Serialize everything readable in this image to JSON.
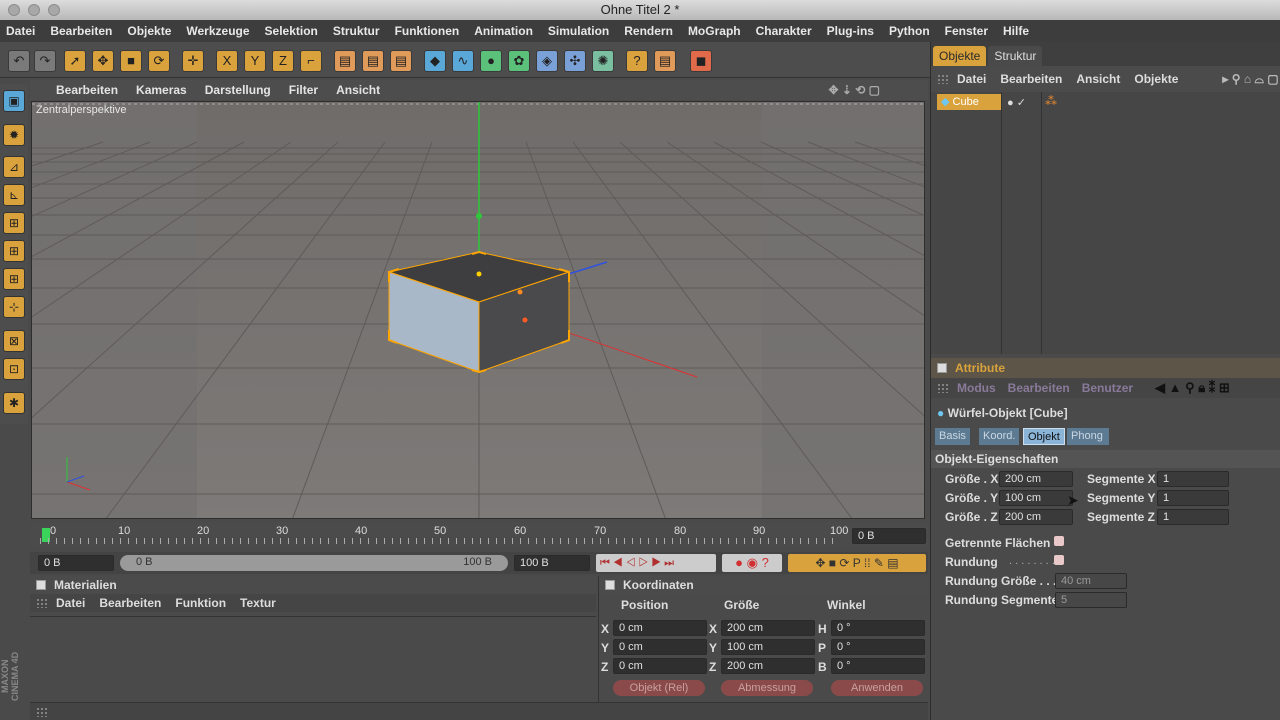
{
  "window": {
    "title": "Ohne Titel 2 *"
  },
  "menu": [
    "Datei",
    "Bearbeiten",
    "Objekte",
    "Werkzeuge",
    "Selektion",
    "Struktur",
    "Funktionen",
    "Animation",
    "Simulation",
    "Rendern",
    "MoGraph",
    "Charakter",
    "Plug-ins",
    "Python",
    "Fenster",
    "Hilfe"
  ],
  "toolbar_icons": [
    "undo-icon",
    "redo-icon",
    "select-icon",
    "move-icon",
    "scale-icon",
    "rotate-icon",
    "move-tool-icon",
    "x-axis-icon",
    "y-axis-icon",
    "z-axis-icon",
    "coordinate-system-icon",
    "render-view-icon",
    "render-picture-icon",
    "render-settings-icon",
    "cube-primitive-icon",
    "nurbs-icon",
    "generator-icon",
    "deformer-icon",
    "environment-icon",
    "camera-icon",
    "light-icon",
    "scene-icon",
    "python-icon"
  ],
  "toolbar_labels": {
    "x": "X",
    "y": "Y",
    "z": "Z"
  },
  "viewport": {
    "menu": [
      "Bearbeiten",
      "Kameras",
      "Darstellung",
      "Filter",
      "Ansicht"
    ],
    "label": "Zentralperspektive",
    "accent": "#ffa500"
  },
  "timeline": {
    "ticks": [
      "0",
      "10",
      "20",
      "30",
      "40",
      "50",
      "60",
      "70",
      "80",
      "90",
      "100"
    ],
    "current": "0 B"
  },
  "transport": {
    "start": "0 B",
    "range_start": "0 B",
    "range_end": "100 B",
    "end": "100 B"
  },
  "materials": {
    "title": "Materialien",
    "menu": [
      "Datei",
      "Bearbeiten",
      "Funktion",
      "Textur"
    ]
  },
  "coordinates": {
    "title": "Koordinaten",
    "headers": [
      "Position",
      "Größe",
      "Winkel"
    ],
    "rows": [
      {
        "axis": "X",
        "pos": "0 cm",
        "size_axis": "X",
        "size": "200 cm",
        "rot_axis": "H",
        "rot": "0 °"
      },
      {
        "axis": "Y",
        "pos": "0 cm",
        "size_axis": "Y",
        "size": "100 cm",
        "rot_axis": "P",
        "rot": "0 °"
      },
      {
        "axis": "Z",
        "pos": "0 cm",
        "size_axis": "Z",
        "size": "200 cm",
        "rot_axis": "B",
        "rot": "0 °"
      }
    ],
    "buttons": [
      "Objekt (Rel)",
      "Abmessung",
      "Anwenden"
    ]
  },
  "objects": {
    "tabs": [
      "Objekte",
      "Struktur"
    ],
    "menu": [
      "Datei",
      "Bearbeiten",
      "Ansicht",
      "Objekte"
    ],
    "items": [
      {
        "name": "Cube"
      }
    ]
  },
  "attributes": {
    "title": "Attribute",
    "menu": [
      "Modus",
      "Bearbeiten",
      "Benutzer"
    ],
    "object_title": "Würfel-Objekt [Cube]",
    "tabs": [
      "Basis",
      "Koord.",
      "Objekt",
      "Phong"
    ],
    "section": "Objekt-Eigenschaften",
    "fields": [
      {
        "label": "Größe . X",
        "value": "200 cm",
        "seg_label": "Segmente X",
        "seg": "1"
      },
      {
        "label": "Größe . Y",
        "value": "100 cm",
        "seg_label": "Segmente Y",
        "seg": "1"
      },
      {
        "label": "Größe . Z",
        "value": "200 cm",
        "seg_label": "Segmente Z",
        "seg": "1"
      }
    ],
    "separate_faces": "Getrennte Flächen",
    "fillet": "Rundung",
    "fillet_size_label": "Rundung Größe . . . .",
    "fillet_size": "40 cm",
    "fillet_seg_label": "Rundung Segmente",
    "fillet_seg": "5"
  },
  "brand": "MAXON CINEMA 4D"
}
